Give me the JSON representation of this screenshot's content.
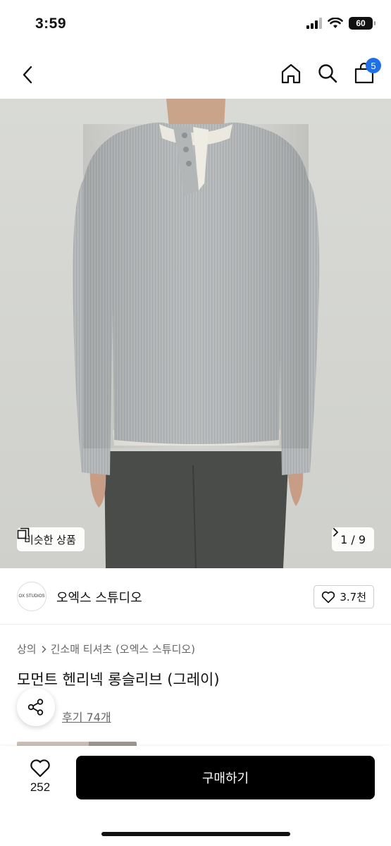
{
  "status_bar": {
    "time": "3:59",
    "battery": "60",
    "icons": [
      "signal-icon",
      "wifi-icon",
      "battery-icon"
    ]
  },
  "nav": {
    "icons": [
      "back-chevron-icon",
      "home-icon",
      "search-icon",
      "shopping-bag-icon"
    ],
    "cart_count": "5",
    "badge_color": "#1f6fe8"
  },
  "gallery": {
    "similar_label": "비슷한 상품",
    "page_indicator": "1 / 9",
    "icons": [
      "copy-icon",
      "chevron-right-icon"
    ]
  },
  "brand": {
    "logo_text": "OX STUDIOS",
    "name": "오엑스 스튜디오",
    "likes": "3.7천",
    "icons": [
      "heart-outline-icon"
    ]
  },
  "product": {
    "breadcrumb": [
      "상의",
      "긴소매 티셔츠 (오엑스 스튜디오)"
    ],
    "title": "모먼트 헨리넥 롱슬리브 (그레이)",
    "reviews": "후기 74개",
    "icons": [
      "share-icon",
      "chevron-right-icon"
    ]
  },
  "bottom_bar": {
    "wish_count": "252",
    "buy_label": "구매하기",
    "buy_color": "#000000",
    "icons": [
      "heart-outline-icon"
    ]
  }
}
